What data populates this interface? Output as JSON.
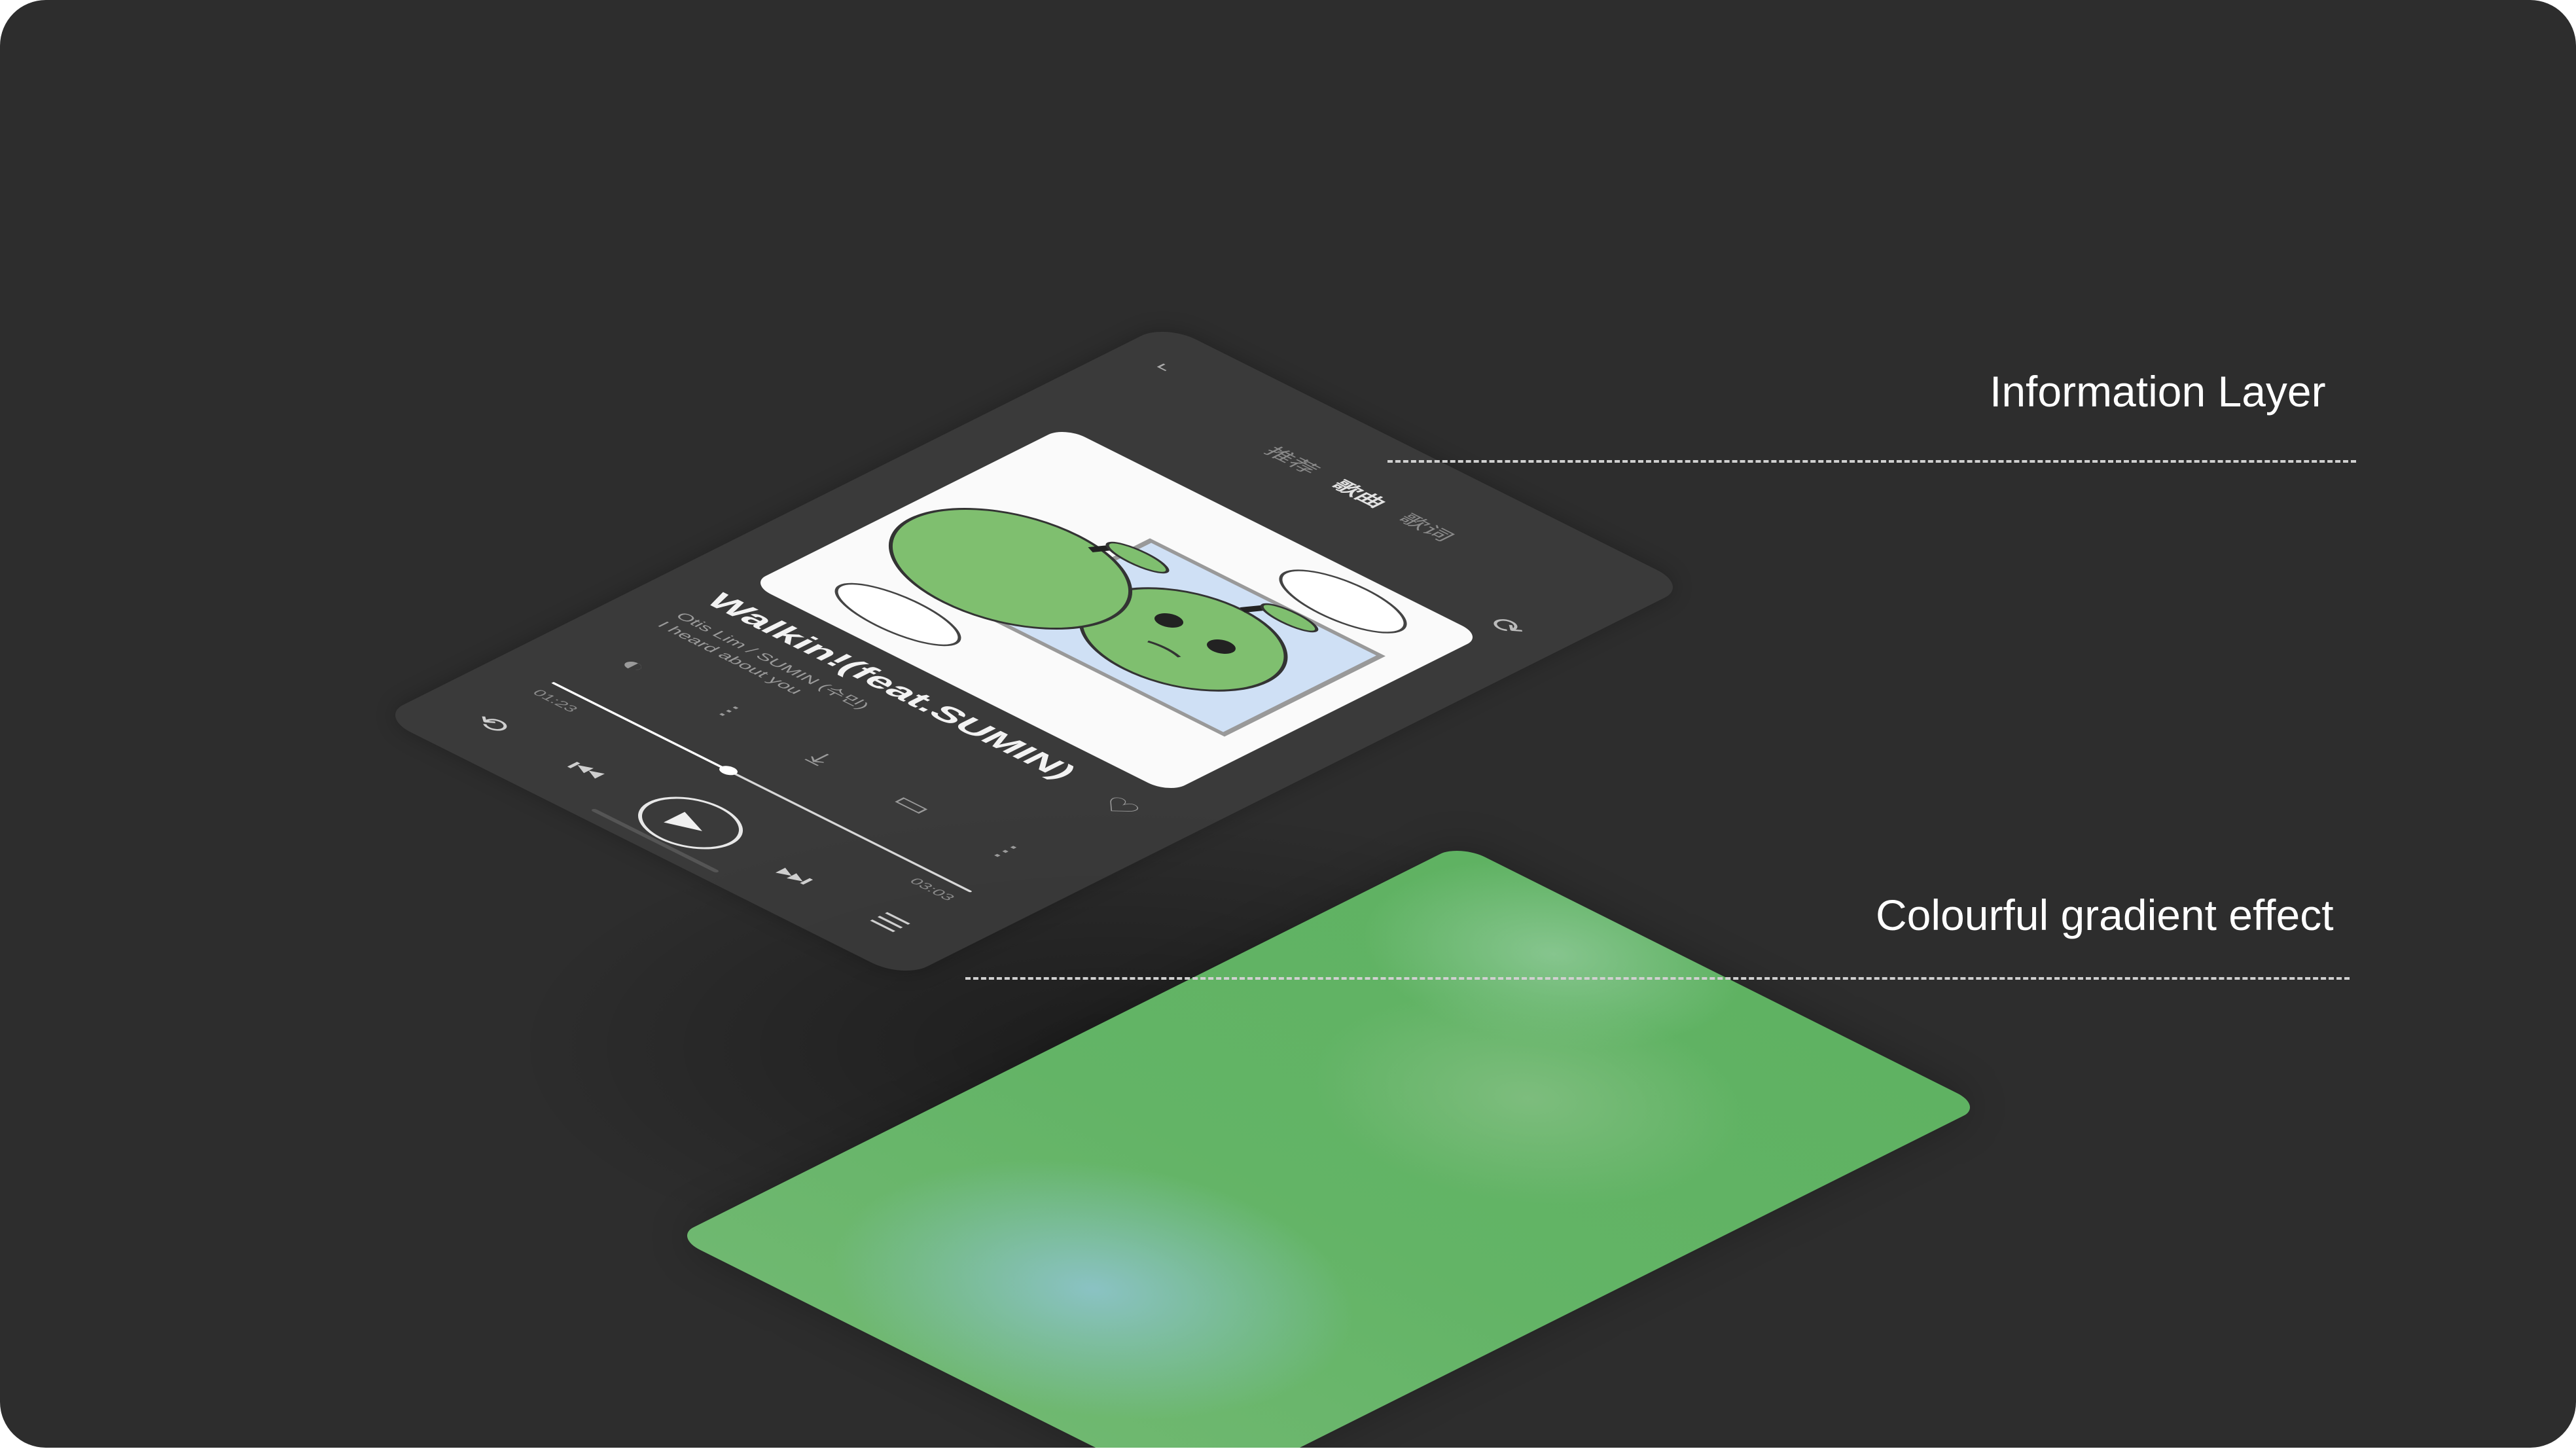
{
  "annotations": {
    "info_layer": "Information Layer",
    "gradient_effect": "Colourful gradient effect"
  },
  "player": {
    "tabs": [
      "推荐",
      "歌曲",
      "歌词"
    ],
    "active_tab_index": 1,
    "song_title": "Walkin!(feat.SUMIN)",
    "artist": "Otis Lim / SUMIN (수민)",
    "lyric": "I heard about you",
    "time_current": "01:23",
    "time_total": "03:03",
    "progress": 0.42,
    "icons": {
      "back": "back-icon",
      "share": "share-icon",
      "favorite": "heart-icon",
      "function_row": [
        "voice-effect-icon",
        "equalizer-icon",
        "download-icon",
        "comment-icon",
        "more-icon"
      ],
      "controls": [
        "repeat-icon",
        "previous-icon",
        "play-icon",
        "next-icon",
        "playlist-icon"
      ]
    }
  },
  "colors": {
    "background": "#2d2d2d",
    "gradient_green": "#63b466",
    "gradient_teal": "#8cc3c8",
    "info_panel": "#3e3e3e"
  }
}
